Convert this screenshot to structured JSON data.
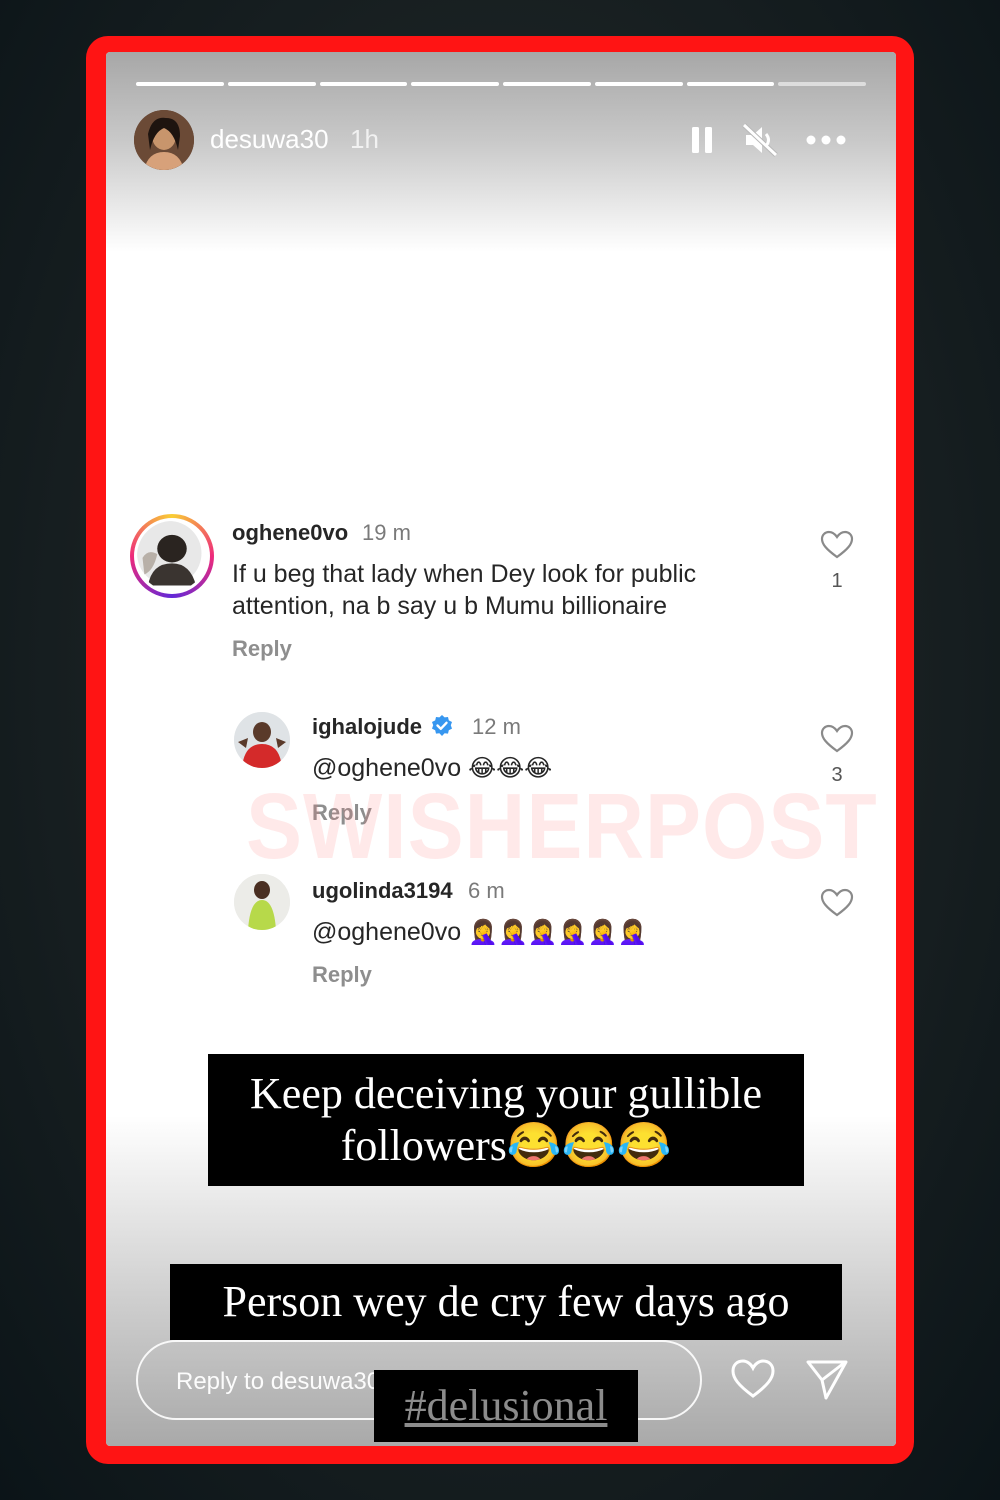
{
  "story": {
    "username": "desuwa30",
    "time": "1h",
    "segments_total": 8,
    "segments_viewed": 7,
    "icons": {
      "pause": "pause-icon",
      "mute": "muted-speaker-icon",
      "more": "more-options-icon"
    }
  },
  "comments": [
    {
      "username": "oghene0vo",
      "time": "19 m",
      "line1": "If u beg that lady when Dey look for public",
      "line2": "attention, na b say u b Mumu billionaire",
      "reply": "Reply",
      "likes": "1"
    },
    {
      "username": "ighalojude",
      "verified": true,
      "time": "12 m",
      "mention": "@oghene0vo",
      "emojis": "😂😂😂",
      "reply": "Reply",
      "likes": "3"
    },
    {
      "username": "ugolinda3194",
      "time": "6 m",
      "mention": "@oghene0vo",
      "emojis": "🤦‍♀️🤦‍♀️🤦‍♀️🤦‍♀️🤦‍♀️🤦‍♀️",
      "reply": "Reply"
    }
  ],
  "watermark": "SWISHERPOST",
  "caption": {
    "line1": "Keep deceiving your gullible",
    "line2": "followers😂😂😂",
    "second": "Person wey de cry few days ago",
    "hashtag": "#delusional"
  },
  "footer": {
    "reply_placeholder": "Reply to desuwa30...",
    "icons": {
      "like": "heart-icon",
      "share": "send-icon"
    }
  },
  "colors": {
    "frame": "#ff1414",
    "verified": "#3797f0"
  }
}
